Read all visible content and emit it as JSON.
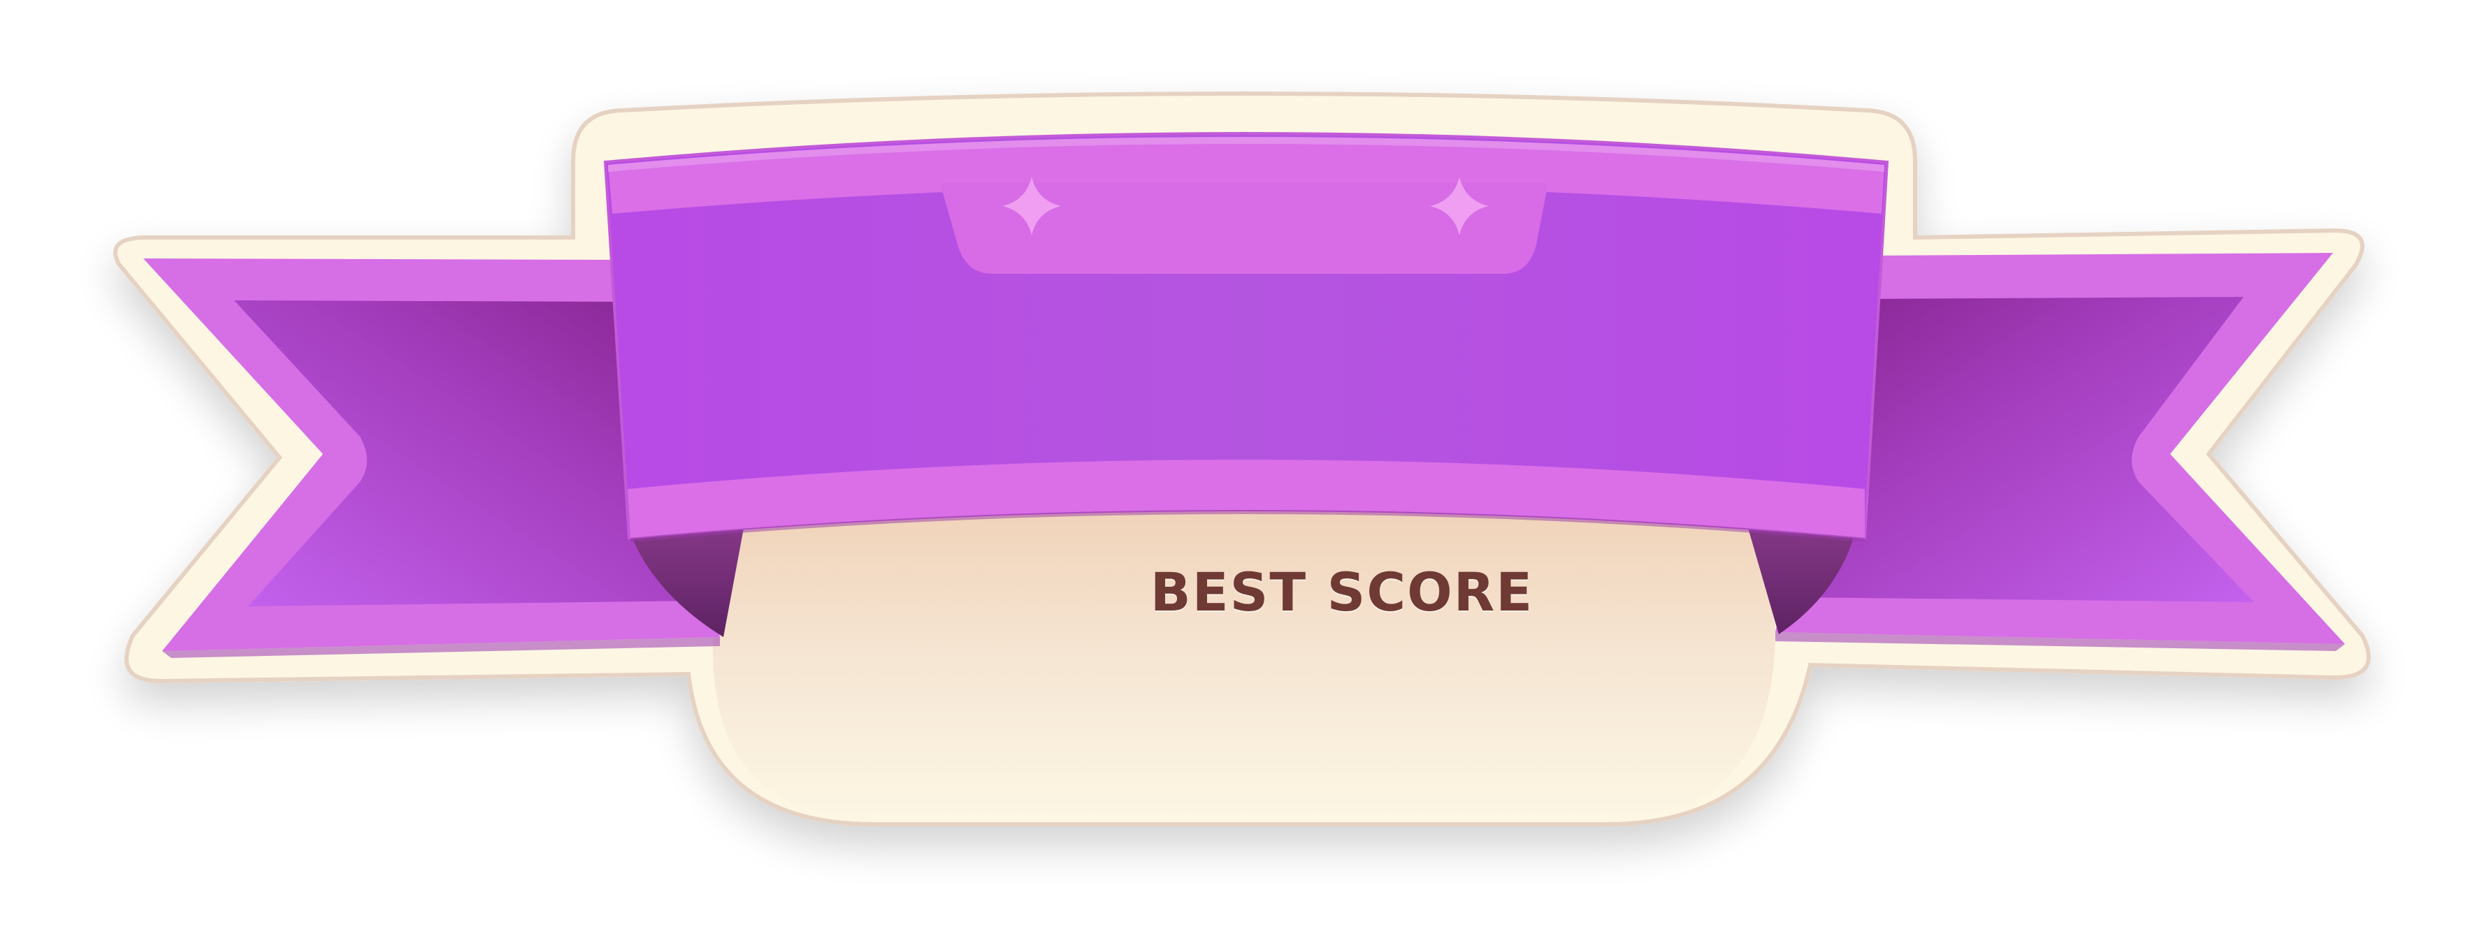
{
  "badge": {
    "label": "BEST SCORE",
    "sparkle_icons": [
      "sparkle-icon",
      "sparkle-icon"
    ]
  },
  "colors": {
    "ribbon_purple": "#b24ce6",
    "ribbon_highlight": "#da6fe8",
    "ribbon_dark": "#7a2a7e",
    "outline_cream": "#fdf6e3",
    "plate_cream": "#fbf1de",
    "plate_peach": "#f2d7c0",
    "label_text": "#6f3a34"
  }
}
